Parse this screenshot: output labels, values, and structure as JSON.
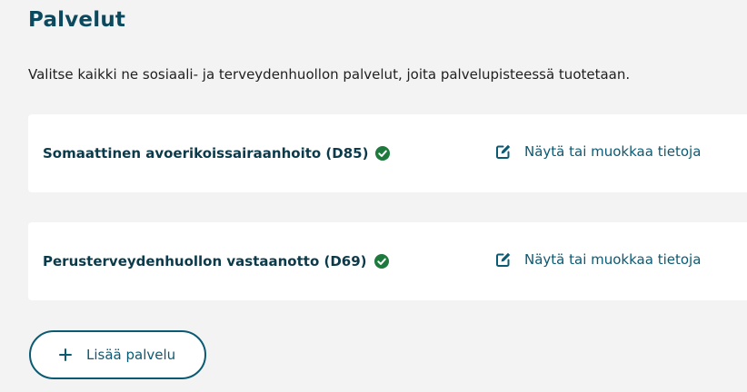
{
  "page": {
    "title": "Palvelut",
    "description": "Valitse kaikki ne sosiaali- ja terveydenhuollon palvelut, joita palvelupisteessä tuotetaan."
  },
  "services": [
    {
      "name": "Somaattinen avoerikoissairaanhoito (D85)",
      "status_icon": "check-circle-icon",
      "edit_label": "Näytä tai muokkaa tietoja",
      "edit_icon": "edit-icon"
    },
    {
      "name": "Perusterveydenhuollon vastaanotto (D69)",
      "status_icon": "check-circle-icon",
      "edit_label": "Näytä tai muokkaa tietoja",
      "edit_icon": "edit-icon"
    }
  ],
  "add_button": {
    "label": "Lisää palvelu",
    "icon": "plus-icon"
  },
  "colors": {
    "background": "#f3f3f3",
    "primary": "#0b5a73",
    "heading": "#0b4a5e",
    "success": "#1e7a3c",
    "card": "#ffffff"
  }
}
